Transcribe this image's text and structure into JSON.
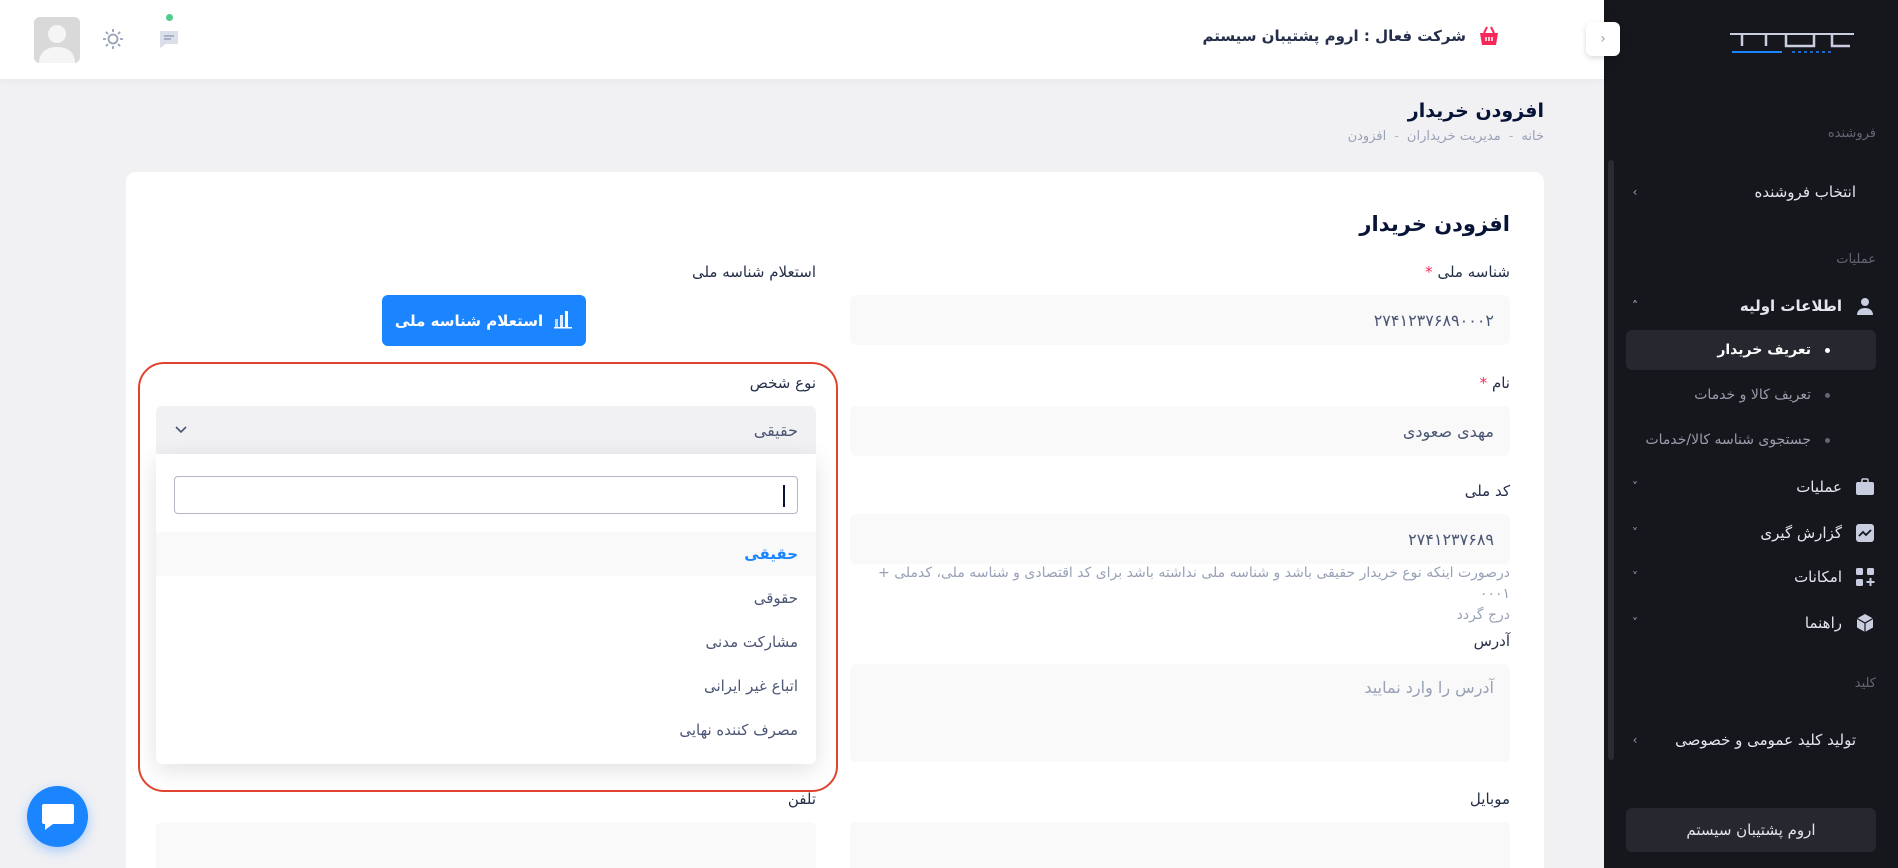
{
  "sidebar": {
    "logo_text": "آساد",
    "sections": {
      "seller": "فروشنده",
      "operations": "عملیات",
      "key": "کلید"
    },
    "select_seller": "انتخاب فروشنده",
    "basic_info": "اطلاعات اولیه",
    "sub_items": [
      "تعریف خریدار",
      "تعریف کالا و خدمات",
      "جستجوی شناسه کالا/خدمات"
    ],
    "operations_item": "عملیات",
    "reporting": "گزارش گیری",
    "features": "امکانات",
    "guide": "راهنما",
    "keygen": "تولید کلید عمومی و خصوصی",
    "footer_company": "اروم پشتیبان سیستم"
  },
  "header": {
    "active_company": "شرکت فعال : اروم پشتیبان سیستم"
  },
  "page": {
    "title": "افزودن خریدار",
    "breadcrumb": [
      "خانه",
      "مدیریت خریداران",
      "افزودن"
    ]
  },
  "form": {
    "title": "افزودن خریدار",
    "national_id_label": "شناسه ملی",
    "national_id_value": "۲۷۴۱۲۳۷۶۸۹۰۰۰۲",
    "inquiry_label": "استعلام شناسه ملی",
    "inquiry_button": "استعلام شناسه ملی",
    "name_label": "نام",
    "name_value": "مهدی صعودی",
    "person_type_label": "نوع شخص",
    "person_type_value": "حقیقی",
    "person_type_options": [
      "حقیقی",
      "حقوقی",
      "مشارکت مدنی",
      "اتباع غیر ایرانی",
      "مصرف کننده نهایی"
    ],
    "national_code_label": "کد ملی",
    "national_code_value": "۲۷۴۱۲۳۷۶۸۹",
    "hint_line1": "درصورت اینکه نوع خریدار حقیقی باشد و شناسه ملی نداشته باشد برای کد اقتصادی و شناسه ملی، کدملی + ۰۰۰۱",
    "hint_line2": "درج گردد",
    "address_label": "آدرس",
    "address_placeholder": "آدرس را وارد نمایید",
    "mobile_label": "موبایل",
    "phone_label": "تلفن",
    "required_mark": "*"
  },
  "colors": {
    "primary": "#1b84ff",
    "sidebar_bg": "#15171c",
    "highlight": "#e0432f"
  }
}
